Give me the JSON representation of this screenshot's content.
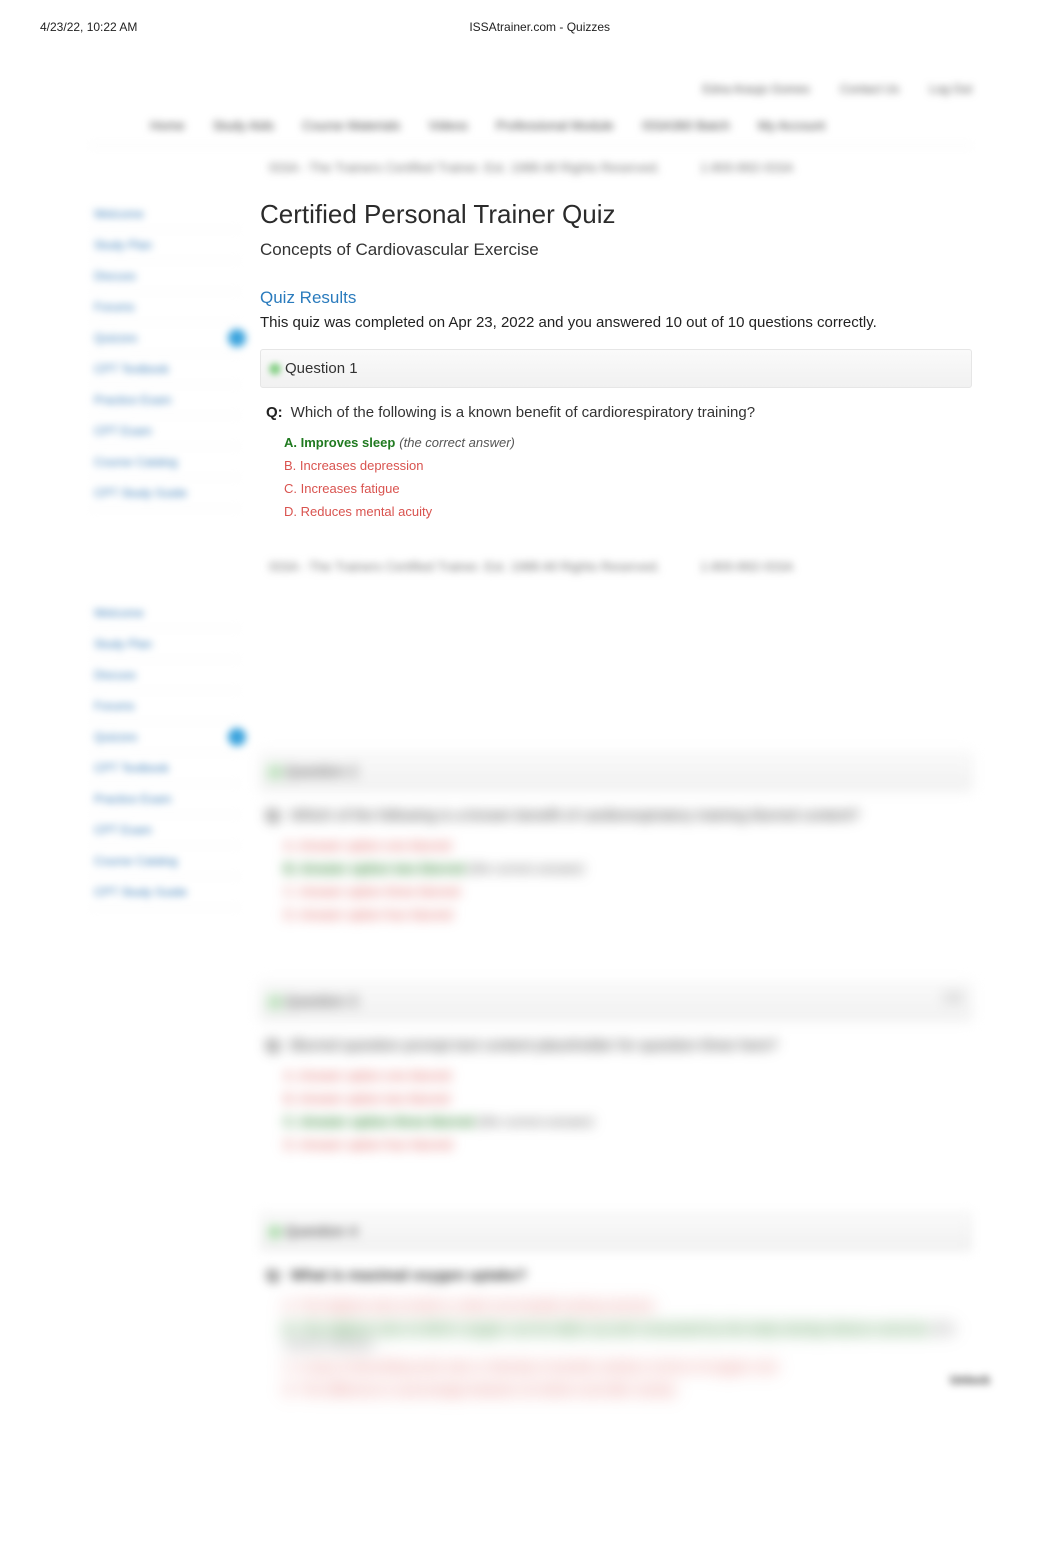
{
  "print": {
    "datetime": "4/23/22, 10:22 AM",
    "title": "ISSAtrainer.com - Quizzes"
  },
  "topbar": {
    "welcome": "Edna Araujo Gomes",
    "contact": "Contact Us",
    "logout": "Log Out"
  },
  "nav": [
    "Home",
    "Study Aids",
    "Course Materials",
    "Videos",
    "Professional Module",
    "ISSA360 Batch",
    "My Account"
  ],
  "subbar": {
    "left": "ISSA - The Trainers Certified Trainer. Est. 1988 All Rights Reserved.",
    "right": "1-800-892-ISSA"
  },
  "sidebar": {
    "items": [
      {
        "label": "Welcome"
      },
      {
        "label": "Study Plan"
      },
      {
        "label": "Discuss"
      },
      {
        "label": "Forums"
      },
      {
        "label": "Quizzes",
        "active": true
      },
      {
        "label": "CPT Textbook"
      },
      {
        "label": "Practice Exam"
      },
      {
        "label": "CPT Exam"
      },
      {
        "label": "Course Catalog"
      },
      {
        "label": "CPT Study Guide"
      }
    ]
  },
  "page": {
    "title": "Certified Personal Trainer Quiz",
    "subtitle": "Concepts of Cardiovascular Exercise",
    "results_head": "Quiz Results",
    "results_summary": "This quiz was completed on Apr 23, 2022 and you answered 10 out of 10 questions correctly."
  },
  "q_label": "Q:",
  "questions": [
    {
      "num": "Question 1",
      "prompt": "Which of the following is a known benefit of cardiorespiratory training?",
      "answers": [
        {
          "text": "A. Improves sleep",
          "correct": true,
          "hint": "(the correct answer)"
        },
        {
          "text": "B. Increases depression"
        },
        {
          "text": "C. Increases fatigue"
        },
        {
          "text": "D. Reduces mental acuity"
        }
      ]
    },
    {
      "num": "Question 2",
      "prompt": "Which of the following is a known benefit of cardiorespiratory training blurred content?",
      "answers": [
        {
          "text": "A. Answer option one blurred"
        },
        {
          "text": "B. Answer option two blurred",
          "correct": true,
          "hint": "(the correct answer)"
        },
        {
          "text": "C. Answer option three blurred"
        },
        {
          "text": "D. Answer option four blurred"
        }
      ]
    },
    {
      "num": "Question 3",
      "prompt": "Blurred question prompt text content placeholder for question three here?",
      "right_tag": "1 pt",
      "answers": [
        {
          "text": "A. Answer option one blurred"
        },
        {
          "text": "B. Answer option two blurred"
        },
        {
          "text": "C. Answer option three blurred",
          "correct": true,
          "hint": "(the correct answer)"
        },
        {
          "text": "D. Answer option four blurred"
        }
      ]
    },
    {
      "num": "Question 4",
      "prompt": "What is maximal oxygen uptake?",
      "answers": [
        {
          "text": "A. The highest rate at which a client can breathe during exercise"
        },
        {
          "text": "B. The highest rate at which oxygen can be taken up and consumed by the body during intense exercise",
          "correct": true,
          "hint": "(the correct answer)"
        },
        {
          "text": "C. A way of describing work rate or intensity of aerobic activity in terms of oxygen cost"
        },
        {
          "text": "D. The difference in percentage between air before and after activity"
        }
      ],
      "badge": "Unlock"
    }
  ]
}
